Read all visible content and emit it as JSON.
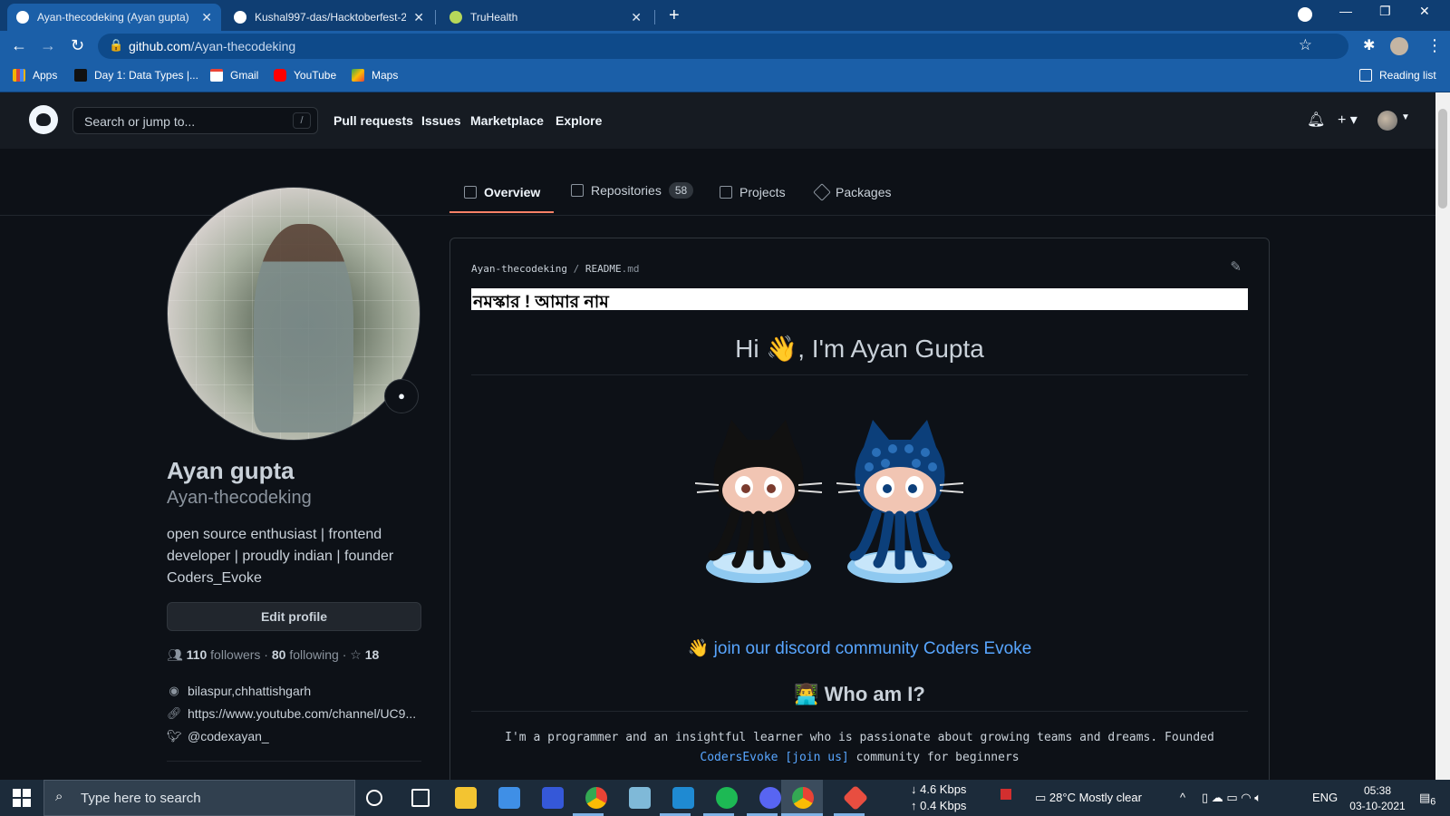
{
  "browser": {
    "tabs": [
      {
        "title": "Ayan-thecodeking (Ayan gupta)",
        "active": true
      },
      {
        "title": "Kushal997-das/Hacktoberfest-20",
        "active": false
      },
      {
        "title": "TruHealth",
        "active": false
      }
    ],
    "url_host": "github.com",
    "url_path": "/Ayan-thecodeking",
    "bookmarks": [
      "Apps",
      "Day 1: Data Types |...",
      "Gmail",
      "YouTube",
      "Maps"
    ],
    "reading_list": "Reading list"
  },
  "github_header": {
    "search_placeholder": "Search or jump to...",
    "search_shortcut": "/",
    "nav": [
      "Pull requests",
      "Issues",
      "Marketplace",
      "Explore"
    ]
  },
  "profile_tabs": {
    "overview": "Overview",
    "repositories": "Repositories",
    "repositories_count": "58",
    "projects": "Projects",
    "packages": "Packages"
  },
  "profile": {
    "name": "Ayan gupta",
    "login": "Ayan-thecodeking",
    "bio": "open source enthusiast | frontend developer | proudly indian | founder Coders_Evoke",
    "edit_button": "Edit profile",
    "followers_count": "110",
    "followers_label": "followers",
    "following_count": "80",
    "following_label": "following",
    "stars_count": "18",
    "location": "bilaspur,chhattishgarh",
    "website": "https://www.youtube.com/channel/UC9...",
    "twitter": "@codexayan_"
  },
  "readme": {
    "path_owner": "Ayan-thecodeking",
    "path_sep": "/",
    "path_file": "README",
    "path_ext": ".md",
    "banner": "নমস্কার ! আমার নাম",
    "heading": "Hi 👋, I'm Ayan Gupta",
    "discord_link": "👋 join our discord community Coders Evoke",
    "who_heading": "👨‍💻 Who am I?",
    "intro_line1": "I'm a programmer and an insightful learner who is passionate about growing teams and dreams. Founded",
    "intro_link": "CodersEvoke [join us]",
    "intro_line2_rest": " community for beginners"
  },
  "taskbar": {
    "search_placeholder": "Type here to search",
    "net_down": "↓ 4.6 Kbps",
    "net_up": "↑ 0.4 Kbps",
    "weather": "28°C  Mostly clear",
    "language": "ENG",
    "time": "05:38",
    "date": "03-10-2021",
    "notifications": "6"
  },
  "colors": {
    "accent_underline": "#f78166",
    "link": "#58a6ff",
    "chrome_blue": "#1b5fa8"
  }
}
